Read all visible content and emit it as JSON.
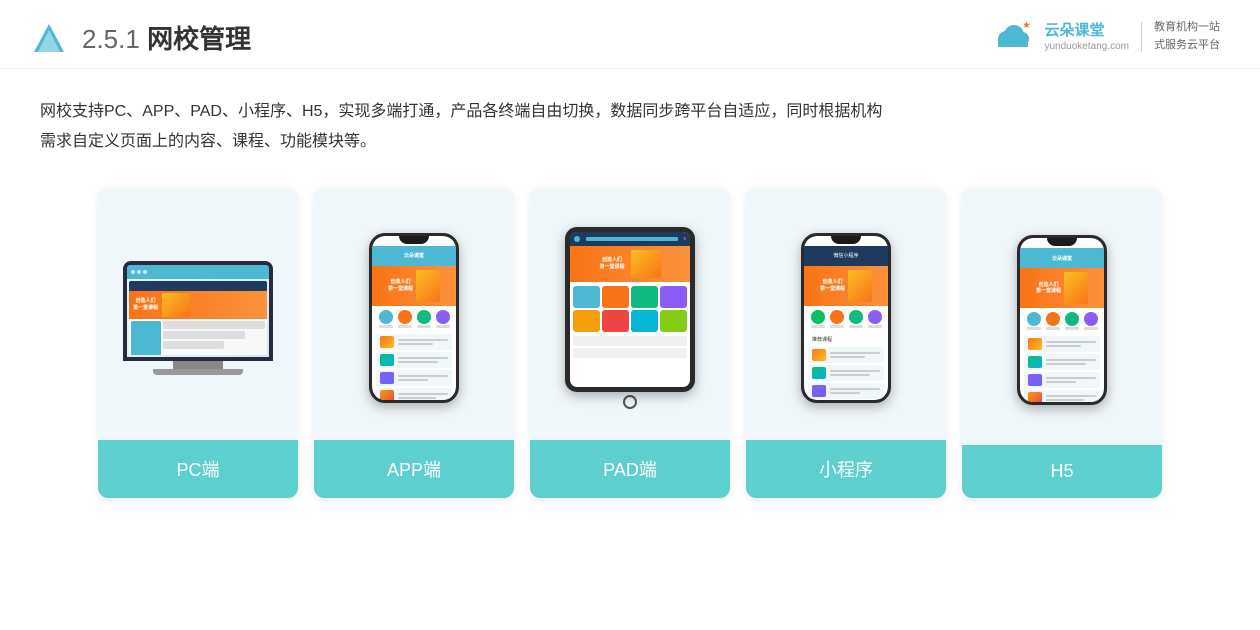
{
  "header": {
    "title_prefix": "2.5.1 ",
    "title_main": "网校管理",
    "logo_alt": "云朵课堂",
    "brand_name": "云朵课堂",
    "brand_url": "yunduoketang.com",
    "brand_slogan_line1": "教育机构一站",
    "brand_slogan_line2": "式服务云平台"
  },
  "description": {
    "text_line1": "网校支持PC、APP、PAD、小程序、H5，实现多端打通，产品各终端自由切换，数据同步跨平台自适应，同时根据机构",
    "text_line2": "需求自定义页面上的内容、课程、功能模块等。"
  },
  "cards": [
    {
      "id": "pc",
      "label": "PC端",
      "type": "monitor"
    },
    {
      "id": "app",
      "label": "APP端",
      "type": "phone"
    },
    {
      "id": "pad",
      "label": "PAD端",
      "type": "tablet"
    },
    {
      "id": "mini",
      "label": "小程序",
      "type": "phone_mini"
    },
    {
      "id": "h5",
      "label": "H5",
      "type": "phone_h5"
    }
  ],
  "accent_color": "#5ecfcf",
  "card_bg": "#e8f4f9"
}
